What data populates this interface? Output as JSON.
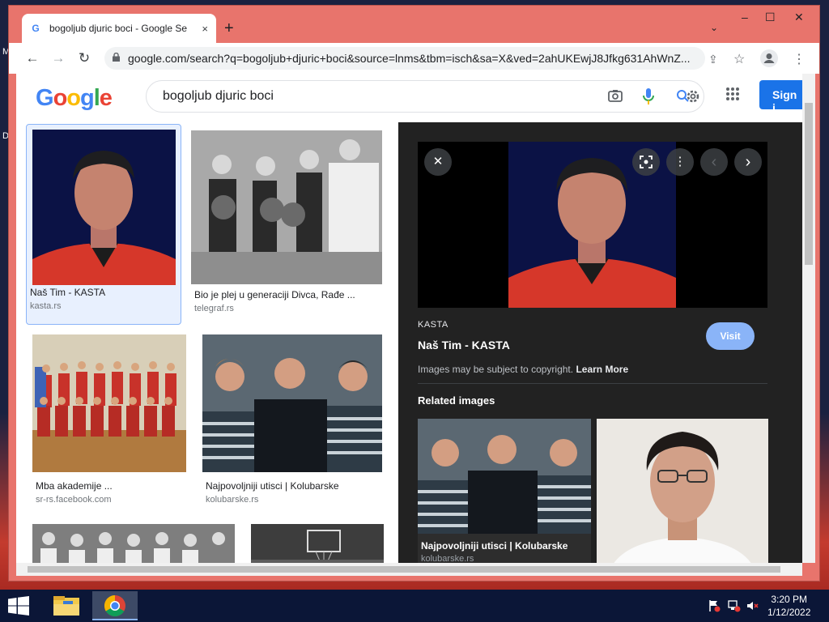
{
  "desktop": {
    "label_m": "M",
    "label_d": "D"
  },
  "browser": {
    "tab_title": "bogoljub djuric boci - Google Se",
    "tab_close": "×",
    "new_tab": "+",
    "tab_search": "⌄",
    "minimize": "–",
    "maximize": "☐",
    "close": "✕",
    "back": "←",
    "forward": "→",
    "reload": "↻",
    "url": "google.com/search?q=bogoljub+djuric+boci&source=lnms&tbm=isch&sa=X&ved=2ahUKEwjJ8Jfkg631AhWnZ...",
    "share": "⇪",
    "star": "☆",
    "menu": "⋮"
  },
  "google": {
    "logo": [
      "G",
      "o",
      "o",
      "g",
      "l",
      "e"
    ],
    "logo_colors": [
      "#4285f4",
      "#ea4335",
      "#fbbc05",
      "#4285f4",
      "#34a853",
      "#ea4335"
    ],
    "query": "bogoljub djuric boci",
    "sign_in": "Sign i"
  },
  "results": [
    {
      "title": "Naš Tim - KASTA",
      "source": "kasta.rs"
    },
    {
      "title": "Bio je plej u generaciji Divca, Rađe ...",
      "source": "telegraf.rs"
    },
    {
      "title": "Mba akademije ...",
      "source": "sr-rs.facebook.com"
    },
    {
      "title": "Najpovoljniji utisci | Kolubarske",
      "source": "kolubarske.rs"
    }
  ],
  "panel": {
    "close": "✕",
    "lens": "⌕",
    "more": "⋮",
    "prev": "‹",
    "next": "›",
    "source": "KASTA",
    "title": "Naš Tim - KASTA",
    "visit": "Visit",
    "copyright": "Images may be subject to copyright.",
    "learn_more": "Learn More",
    "related_heading": "Related images",
    "related": [
      {
        "title": "Najpovoljniji utisci | Kolubarske",
        "source": "kolubarske.rs"
      }
    ]
  },
  "taskbar": {
    "time": "3:20 PM",
    "date": "1/12/2022"
  }
}
